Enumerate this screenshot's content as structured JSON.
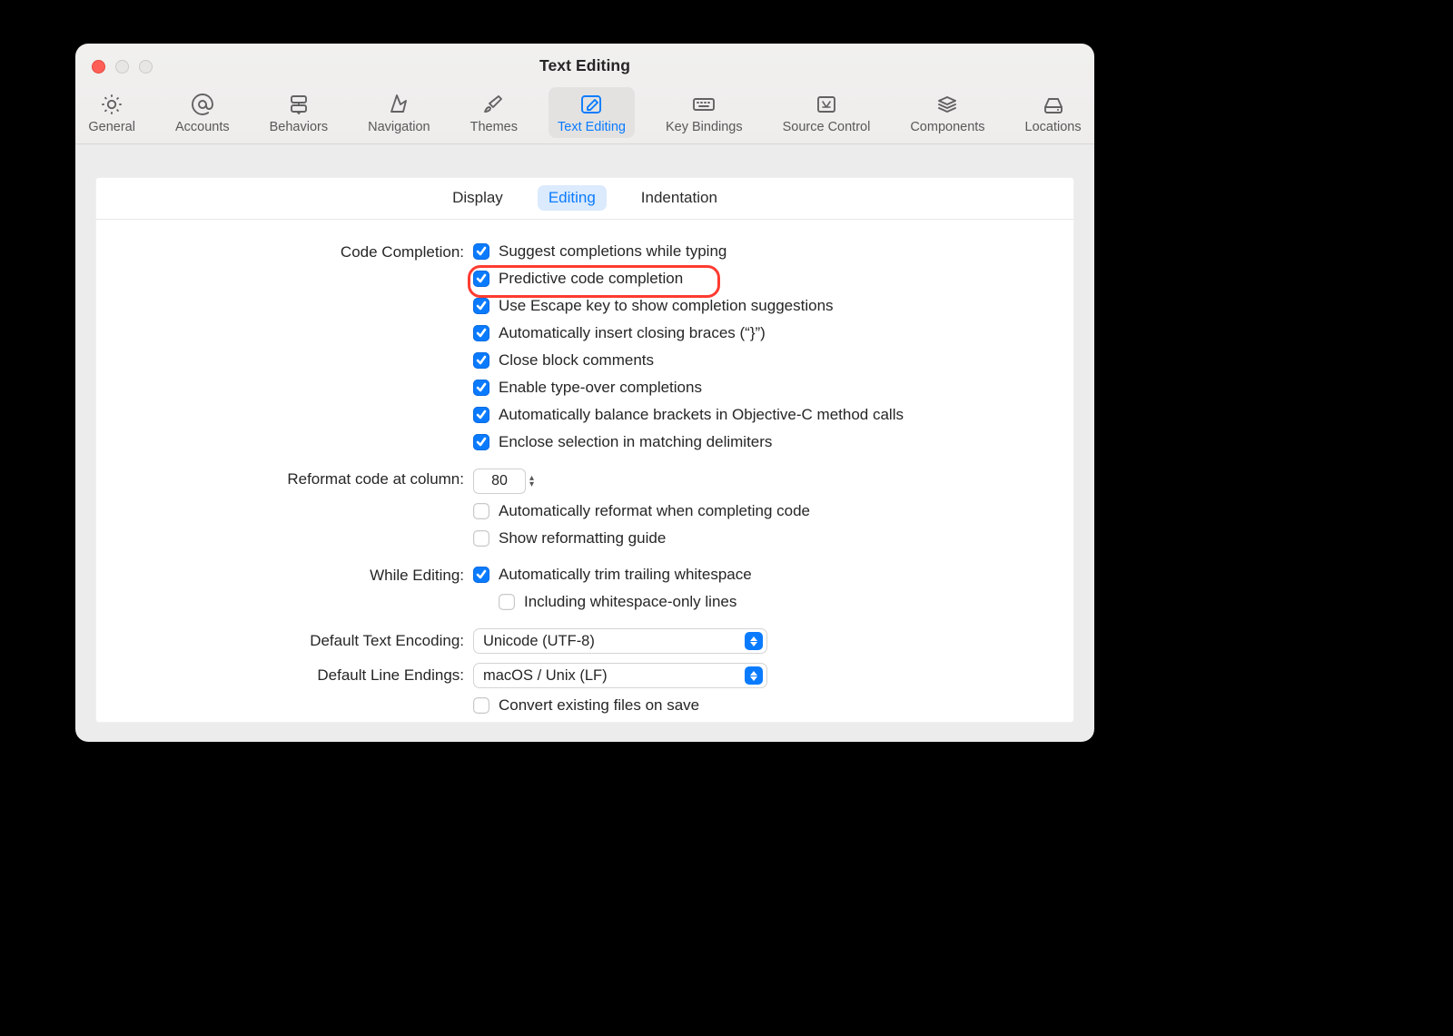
{
  "window": {
    "title": "Text Editing"
  },
  "toolbar": {
    "items": [
      {
        "label": "General"
      },
      {
        "label": "Accounts"
      },
      {
        "label": "Behaviors"
      },
      {
        "label": "Navigation"
      },
      {
        "label": "Themes"
      },
      {
        "label": "Text Editing"
      },
      {
        "label": "Key Bindings"
      },
      {
        "label": "Source Control"
      },
      {
        "label": "Components"
      },
      {
        "label": "Locations"
      }
    ],
    "selected_index": 5
  },
  "subtabs": {
    "items": [
      "Display",
      "Editing",
      "Indentation"
    ],
    "selected_index": 1
  },
  "sections": {
    "code_completion": {
      "label": "Code Completion:",
      "options": [
        {
          "text": "Suggest completions while typing",
          "checked": true
        },
        {
          "text": "Predictive code completion",
          "checked": true,
          "highlighted": true
        },
        {
          "text": "Use Escape key to show completion suggestions",
          "checked": true
        },
        {
          "text": "Automatically insert closing braces (“}”)",
          "checked": true
        },
        {
          "text": "Close block comments",
          "checked": true
        },
        {
          "text": "Enable type-over completions",
          "checked": true
        },
        {
          "text": "Automatically balance brackets in Objective-C method calls",
          "checked": true
        },
        {
          "text": "Enclose selection in matching delimiters",
          "checked": true
        }
      ]
    },
    "reformat": {
      "label": "Reformat code at column:",
      "value": "80",
      "options": [
        {
          "text": "Automatically reformat when completing code",
          "checked": false
        },
        {
          "text": "Show reformatting guide",
          "checked": false
        }
      ]
    },
    "while_editing": {
      "label": "While Editing:",
      "options": [
        {
          "text": "Automatically trim trailing whitespace",
          "checked": true
        },
        {
          "text": "Including whitespace-only lines",
          "checked": false,
          "indent": true
        }
      ]
    },
    "encoding": {
      "label": "Default Text Encoding:",
      "value": "Unicode (UTF-8)"
    },
    "line_endings": {
      "label": "Default Line Endings:",
      "value": "macOS / Unix (LF)",
      "option": {
        "text": "Convert existing files on save",
        "checked": false
      }
    }
  }
}
